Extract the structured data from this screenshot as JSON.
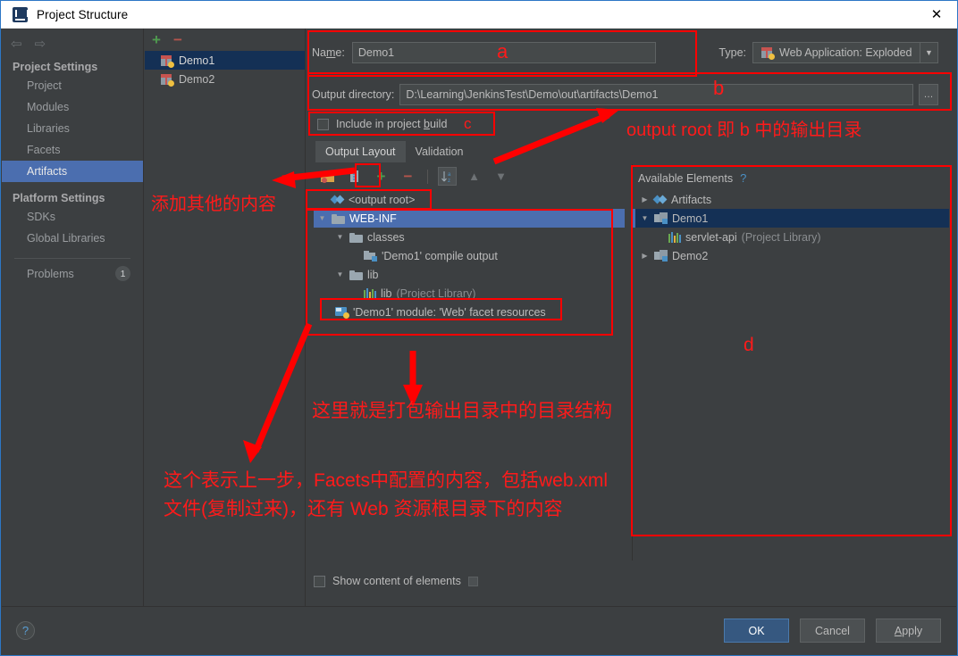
{
  "window": {
    "title": "Project Structure",
    "icon": "intellij-idea-icon",
    "close_label": "✕"
  },
  "sidebar": {
    "nav_back": "⇦",
    "nav_forward": "⇨",
    "groups": [
      {
        "label": "Project Settings",
        "items": [
          {
            "label": "Project",
            "selected": false
          },
          {
            "label": "Modules",
            "selected": false
          },
          {
            "label": "Libraries",
            "selected": false
          },
          {
            "label": "Facets",
            "selected": false
          },
          {
            "label": "Artifacts",
            "selected": true
          }
        ]
      },
      {
        "label": "Platform Settings",
        "items": [
          {
            "label": "SDKs",
            "selected": false
          },
          {
            "label": "Global Libraries",
            "selected": false
          }
        ]
      }
    ],
    "problems": {
      "label": "Problems",
      "count": "1"
    }
  },
  "artifacts_panel": {
    "add_label": "+",
    "remove_label": "−",
    "items": [
      {
        "label": "Demo1",
        "selected": true
      },
      {
        "label": "Demo2",
        "selected": false
      }
    ]
  },
  "editor": {
    "name_label": "Name:",
    "name_value": "Demo1",
    "type_label": "Type:",
    "type_value": "Web Application: Exploded",
    "type_arrow": "▼",
    "output_dir_label": "Output directory:",
    "output_dir_value": "D:\\Learning\\JenkinsTest\\Demo\\out\\artifacts\\Demo1",
    "browse_label": "…",
    "include_label_a": "Include in project ",
    "include_label_b": "build",
    "tabs": [
      {
        "label": "Output Layout",
        "active": true
      },
      {
        "label": "Validation",
        "active": false
      }
    ]
  },
  "layout_toolbar": {
    "create_dir_icon": "folder-add-icon",
    "create_archive_icon": "archive-add-icon",
    "add_icon": "+",
    "remove_icon": "−",
    "sort_icon": "sort-alpha-icon",
    "move_up_icon": "▲",
    "move_down_icon": "▼"
  },
  "output_tree": {
    "root": {
      "label": "<output root>",
      "icon": "artifact-root-icon"
    },
    "nodes": [
      {
        "label": "WEB-INF",
        "icon": "folder-icon",
        "indent": 0,
        "twisty": "▼",
        "selected": true
      },
      {
        "label": "classes",
        "icon": "folder-icon",
        "indent": 1,
        "twisty": "▼",
        "selected": false
      },
      {
        "label": "'Demo1' compile output",
        "icon": "compile-output-icon",
        "indent": 2,
        "twisty": "",
        "selected": false
      },
      {
        "label": "lib",
        "icon": "folder-icon",
        "indent": 1,
        "twisty": "▼",
        "selected": false
      },
      {
        "label": "lib",
        "suffix": "(Project Library)",
        "icon": "library-icon",
        "indent": 2,
        "twisty": "",
        "selected": false
      },
      {
        "label": "'Demo1' module: 'Web' facet resources",
        "icon": "facet-resources-icon",
        "indent": 1,
        "twisty": "",
        "selected": false
      }
    ]
  },
  "available": {
    "title": "Available Elements",
    "help_label": "?",
    "nodes": [
      {
        "label": "Artifacts",
        "icon": "artifacts-diamond-icon",
        "indent": 0,
        "twisty": "▶",
        "selected": false
      },
      {
        "label": "Demo1",
        "icon": "module-icon",
        "indent": 0,
        "twisty": "▼",
        "selected": true
      },
      {
        "label": "servlet-api",
        "suffix": "(Project Library)",
        "icon": "library-icon",
        "indent": 1,
        "twisty": "",
        "selected": false
      },
      {
        "label": "Demo2",
        "icon": "module-icon",
        "indent": 0,
        "twisty": "▶",
        "selected": false
      }
    ]
  },
  "footer": {
    "show_content_label": "Show content of elements",
    "grip_icon": "grip-icon",
    "help_label": "?",
    "buttons": [
      {
        "label": "OK",
        "primary": true
      },
      {
        "label": "Cancel",
        "primary": false
      },
      {
        "label": "Apply",
        "primary": false,
        "mnemonic": "A"
      }
    ]
  },
  "annotations": {
    "accent_color": "#ff0000",
    "labels": {
      "a": "a",
      "b": "b",
      "c": "c",
      "d": "d",
      "add_other": "添加其他的内容",
      "output_root": "output root 即 b 中的输出目录",
      "dir_struct": "这里就是打包输出目录中的目录结构",
      "facet_note_line1": "这个表示上一步，Facets中配置的内容，包括web.xml",
      "facet_note_line2": "文件(复制过来)，还有 Web 资源根目录下的内容"
    }
  }
}
